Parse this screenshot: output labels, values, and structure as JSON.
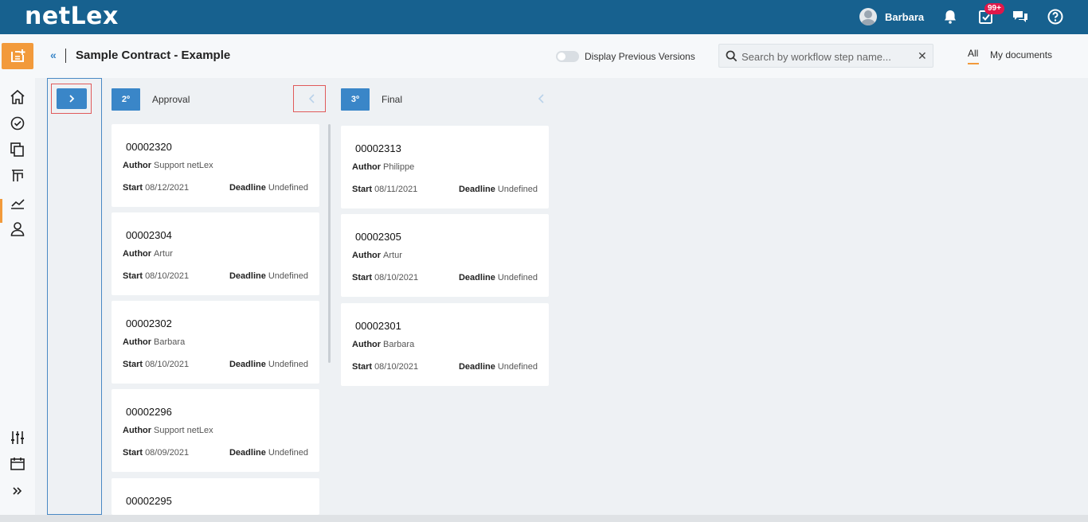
{
  "app": {
    "logo": "netLex"
  },
  "topbar": {
    "user_name": "Barbara",
    "tasks_badge": "99+"
  },
  "header": {
    "title": "Sample Contract - Example",
    "toggle_label": "Display Previous Versions",
    "search_placeholder": "Search by workflow step name...",
    "tabs": {
      "all": "All",
      "mine": "My documents"
    }
  },
  "columns": [
    {
      "step": "2º",
      "name": "Approval",
      "cards": [
        {
          "id": "00002320",
          "author": "Support netLex",
          "start": "08/12/2021",
          "deadline": "Undefined"
        },
        {
          "id": "00002304",
          "author": "Artur",
          "start": "08/10/2021",
          "deadline": "Undefined"
        },
        {
          "id": "00002302",
          "author": "Barbara",
          "start": "08/10/2021",
          "deadline": "Undefined"
        },
        {
          "id": "00002296",
          "author": "Support netLex",
          "start": "08/09/2021",
          "deadline": "Undefined"
        },
        {
          "id": "00002295",
          "author": "",
          "start": "",
          "deadline": ""
        }
      ]
    },
    {
      "step": "3º",
      "name": "Final",
      "cards": [
        {
          "id": "00002313",
          "author": "Philippe",
          "start": "08/11/2021",
          "deadline": "Undefined"
        },
        {
          "id": "00002305",
          "author": "Artur",
          "start": "08/10/2021",
          "deadline": "Undefined"
        },
        {
          "id": "00002301",
          "author": "Barbara",
          "start": "08/10/2021",
          "deadline": "Undefined"
        }
      ]
    }
  ],
  "labels": {
    "author": "Author",
    "start": "Start",
    "deadline": "Deadline"
  },
  "colors": {
    "topbar": "#17618f",
    "accent": "#f29a3b",
    "step_badge": "#3a86c8"
  }
}
